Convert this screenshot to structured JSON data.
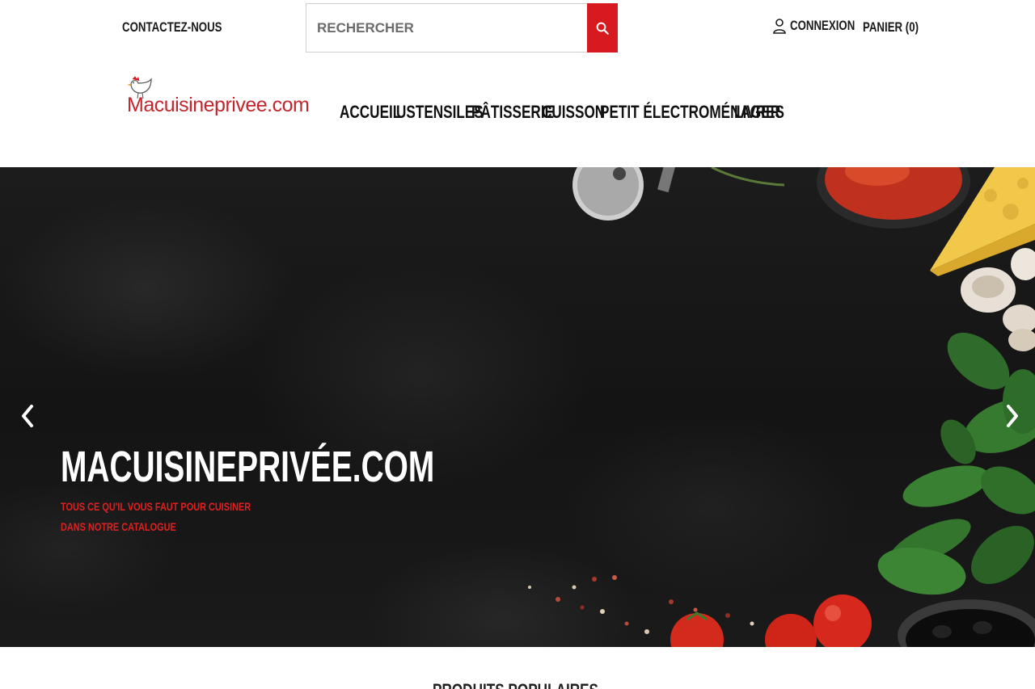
{
  "topbar": {
    "contact_label": "CONTACTEZ-NOUS",
    "search_placeholder": "RECHERCHER",
    "login_label": "CONNEXION",
    "cart_label": "PANIER (0)"
  },
  "header": {
    "logo_text": "Macuisineprivee.com",
    "nav": [
      "ACCUEIL",
      "USTENSILES",
      "PÂTISSERIE",
      "CUISSON",
      "PETIT ÉLECTROMÉNAGER",
      "LIVRES"
    ]
  },
  "hero": {
    "title": "MACUISINEPRIVÉE.COM",
    "subtitle": "TOUS CE QU'IL VOUS FAUT POUR CUISINER DANS NOTRE CATALOGUE"
  },
  "section": {
    "title": "PRODUITS POPULAIRES"
  },
  "colors": {
    "accent": "#d71920",
    "logo": "#c0272d",
    "text": "#111111",
    "hero_bg": "#161616"
  },
  "icons": {
    "search": "search-icon",
    "user": "user-icon",
    "prev": "chevron-left-icon",
    "next": "chevron-right-icon",
    "logo": "chicken-logo-icon"
  }
}
